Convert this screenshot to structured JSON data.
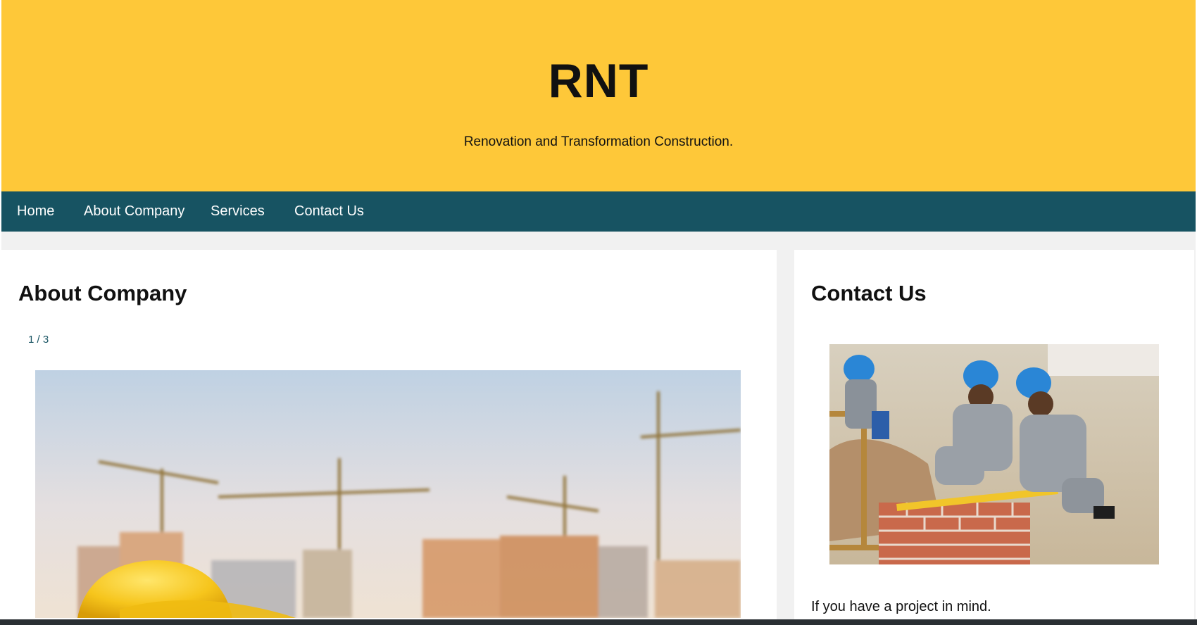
{
  "header": {
    "title": "RNT",
    "tagline": "Renovation and Transformation Construction."
  },
  "nav": {
    "items": [
      {
        "label": "Home"
      },
      {
        "label": "About Company"
      },
      {
        "label": "Services"
      },
      {
        "label": "Contact Us"
      }
    ]
  },
  "about": {
    "heading": "About Company",
    "slide_counter": "1 / 3",
    "slide_image": "construction-cranes-hardhat-image"
  },
  "contact": {
    "heading": "Contact Us",
    "image": "construction-workers-bricklaying-image",
    "text": "If you have a project in mind."
  },
  "colors": {
    "header_bg": "#fec839",
    "nav_bg": "#175362",
    "page_bg": "#f1f1f1",
    "card_bg": "#ffffff"
  }
}
